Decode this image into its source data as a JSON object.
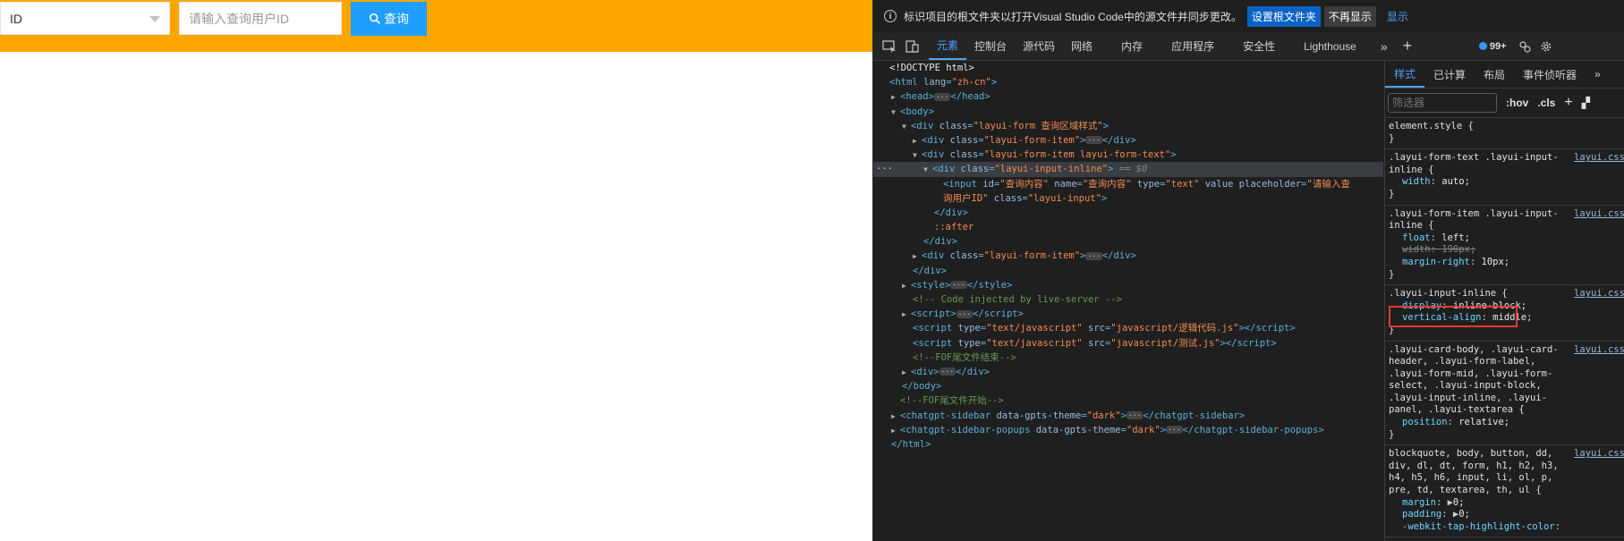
{
  "page": {
    "select_value": "ID",
    "search_placeholder": "请输入查询用户ID",
    "query_button": "查询"
  },
  "devtools": {
    "infobar": {
      "text": "标识项目的根文件夹以打开Visual Studio Code中的源文件并同步更改。",
      "primary_button": "设置根文件夹",
      "secondary_button": "不再显示",
      "more": "显示"
    },
    "tabs": [
      "元素",
      "控制台",
      "源代码",
      "网络",
      "内存",
      "应用程序",
      "安全性",
      "Lighthouse"
    ],
    "issues_badge": "99+",
    "dom": {
      "doctype": "<!DOCTYPE html>",
      "html_open_tag": "html",
      "html_lang_attr": "lang",
      "html_lang_val": "\"zh-cn\"",
      "head": "head",
      "body": "body",
      "div": "div",
      "class_attr": "class",
      "form_class": "\"layui-form 查询区域样式\"",
      "form_item_class": "\"layui-form-item\"",
      "form_item_text_class": "\"layui-form-item layui-form-text\"",
      "input_inline_class": "\"layui-input-inline\"",
      "selected_marker": "== $0",
      "input_tag": "input",
      "input_id_attr": "id",
      "input_id_val": "\"查询内容\"",
      "input_name_attr": "name",
      "input_name_val": "\"查询内容\"",
      "input_type_attr": "type",
      "input_type_val": "\"text\"",
      "input_value_attr": "value",
      "input_placeholder_attr": "placeholder",
      "input_placeholder_val_a": "\"请输入查",
      "input_placeholder_val_b": "询用户ID\"",
      "input_class_val": "\"layui-input\"",
      "after": "::after",
      "style": "style",
      "comment_live_server": "<!-- Code injected by live-server -->",
      "script": "script",
      "script_type_val": "\"text/javascript\"",
      "src_attr": "src",
      "script1_src": "\"javascript/逻辑代码.js\"",
      "script2_src": "\"javascript/测试.js\"",
      "comment_eof_end": "<!--FOF尾文件结束-->",
      "comment_eof_start": "<!--FOF尾文件开始-->",
      "chatgpt_sidebar": "chatgpt-sidebar",
      "chatgpt_popups": "chatgpt-sidebar-popups",
      "theme_attr": "data-gpts-theme",
      "theme_val": "\"dark\""
    },
    "styles": {
      "tabs": [
        "样式",
        "已计算",
        "布局",
        "事件侦听器"
      ],
      "filter_placeholder": "筛选器",
      "hov": ":hov",
      "cls": ".cls",
      "rules": {
        "element_style": "element.style {",
        "r1_selector": ".layui-form-text .layui-input-inline {",
        "r1_source": "layui.css",
        "r1_prop": "width",
        "r1_val": "auto;",
        "r2_selector": ".layui-form-item .layui-input-inline {",
        "r2_source": "layui.css",
        "r2_p1": "float",
        "r2_v1": "left;",
        "r2_p2": "width",
        "r2_v2": "190px;",
        "r2_p3": "margin-right",
        "r2_v3": "10px;",
        "r3_selector": ".layui-input-inline {",
        "r3_source": "layui.css",
        "r3_p1": "display",
        "r3_v1": "inline-block;",
        "r3_p2": "vertical-align",
        "r3_v2": "middle;",
        "r4_selector": ".layui-card-body, .layui-card-header, .layui-form-label, .layui-form-mid, .layui-form-select, .layui-input-block, .layui-input-inline, .layui-panel, .layui-textarea {",
        "r4_source": "layui.css",
        "r4_p1": "position",
        "r4_v1": "relative;",
        "r5_selector": "blockquote, body, button, dd, div, dl, dt, form, h1, h2, h3, h4, h5, h6, input, li, ol, p, pre, td, textarea, th, ul {",
        "r5_source": "layui.css",
        "r5_p1": "margin",
        "r5_v1": "0;",
        "r5_p2": "padding",
        "r5_v2": "0;",
        "r5_p3": "-webkit-tap-highlight-color",
        "close_brace": "}"
      }
    }
  }
}
